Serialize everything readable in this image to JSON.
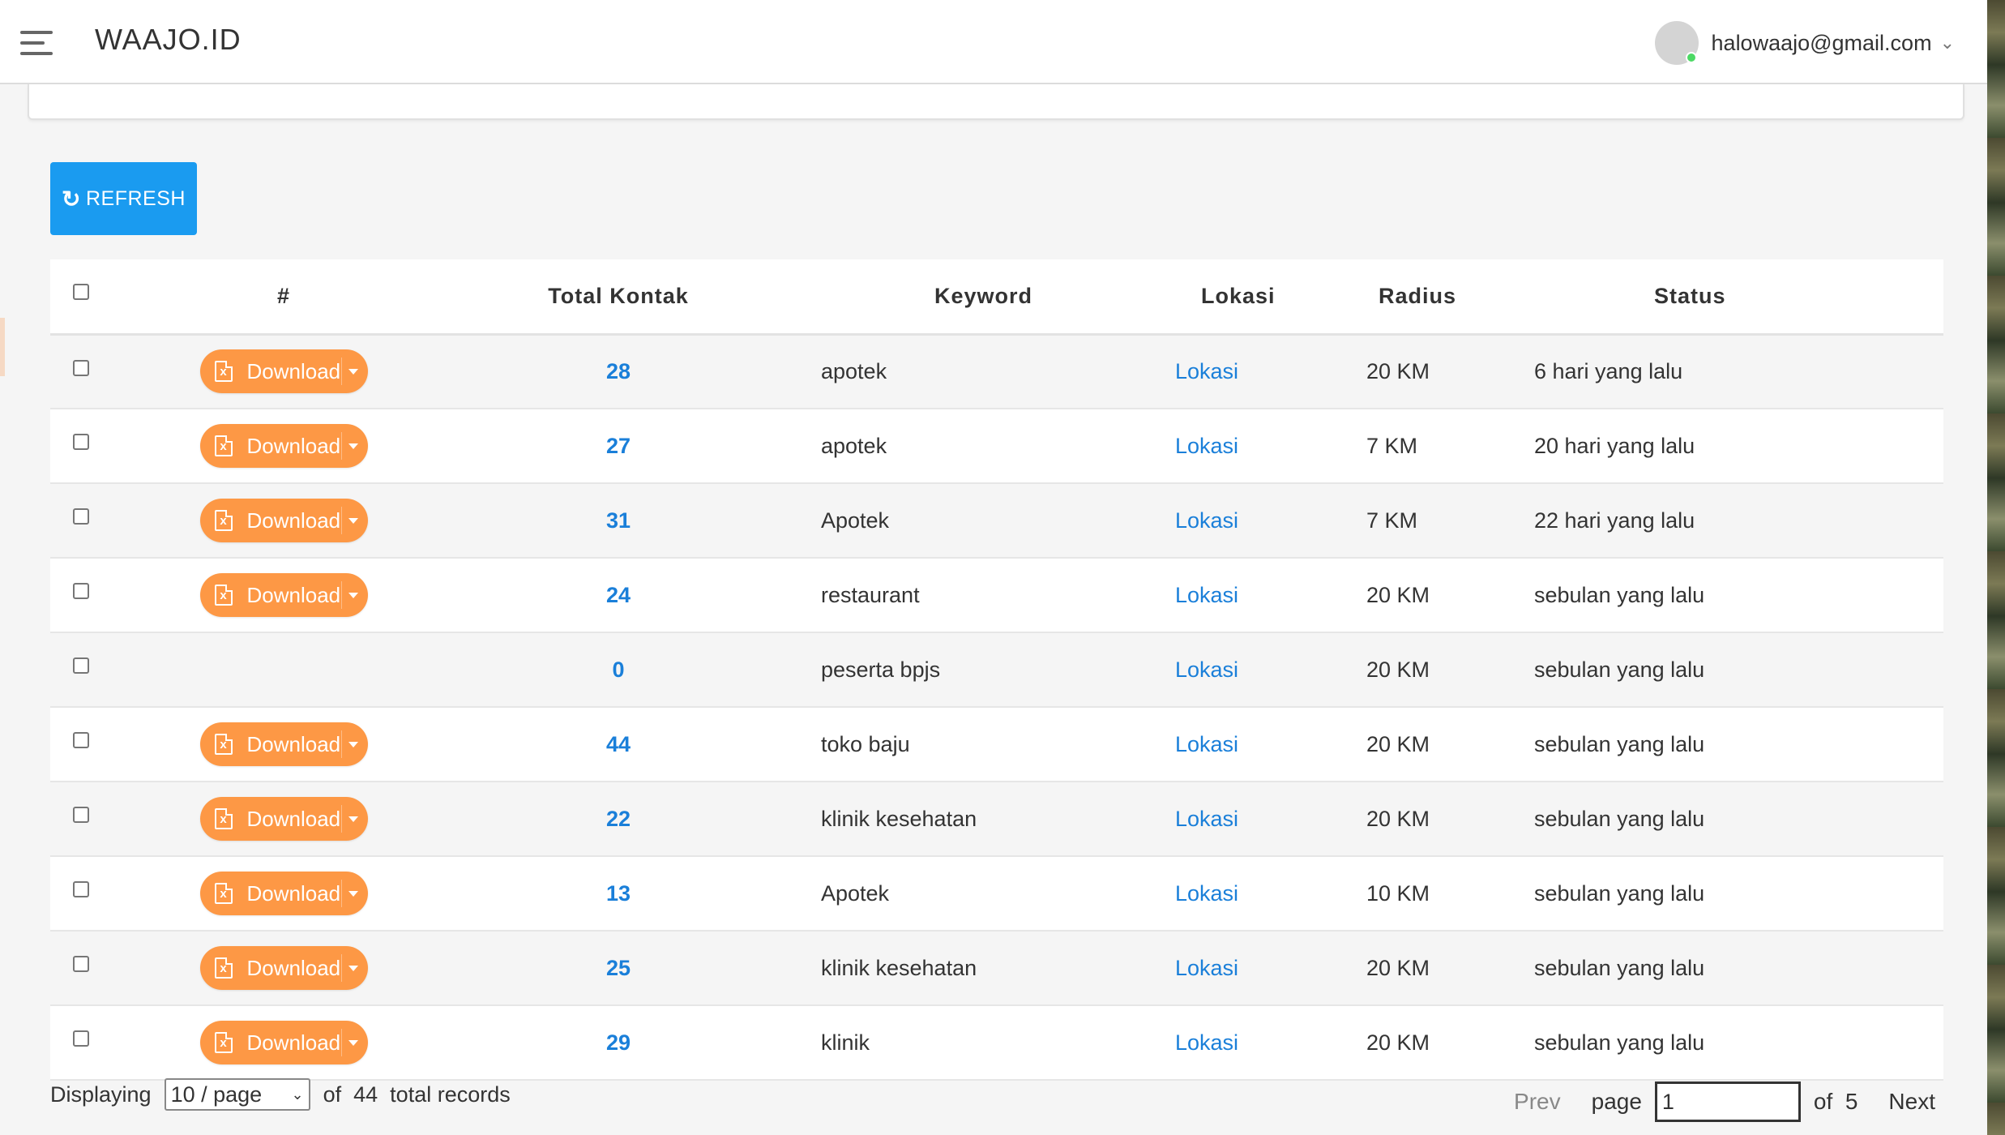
{
  "header": {
    "brand": "WAAJO.ID",
    "user_email": "halowaajo@gmail.com"
  },
  "toolbar": {
    "refresh_label": "REFRESH"
  },
  "table": {
    "columns": [
      "#",
      "Total  Kontak",
      "Keyword",
      "Lokasi",
      "Radius",
      "Status"
    ],
    "download_label": "Download",
    "rows": [
      {
        "has_download": true,
        "total": "28",
        "keyword": "apotek",
        "lokasi": "Lokasi",
        "radius": "20  KM",
        "status": "6  hari  yang  lalu"
      },
      {
        "has_download": true,
        "total": "27",
        "keyword": "apotek",
        "lokasi": "Lokasi",
        "radius": "7  KM",
        "status": "20  hari  yang  lalu"
      },
      {
        "has_download": true,
        "total": "31",
        "keyword": "Apotek",
        "lokasi": "Lokasi",
        "radius": "7  KM",
        "status": "22  hari  yang  lalu"
      },
      {
        "has_download": true,
        "total": "24",
        "keyword": "restaurant",
        "lokasi": "Lokasi",
        "radius": "20  KM",
        "status": "sebulan  yang  lalu"
      },
      {
        "has_download": false,
        "total": "0",
        "keyword": "peserta  bpjs",
        "lokasi": "Lokasi",
        "radius": "20  KM",
        "status": "sebulan  yang  lalu"
      },
      {
        "has_download": true,
        "total": "44",
        "keyword": "toko  baju",
        "lokasi": "Lokasi",
        "radius": "20  KM",
        "status": "sebulan  yang  lalu"
      },
      {
        "has_download": true,
        "total": "22",
        "keyword": "klinik  kesehatan",
        "lokasi": "Lokasi",
        "radius": "20  KM",
        "status": "sebulan  yang  lalu"
      },
      {
        "has_download": true,
        "total": "13",
        "keyword": "Apotek",
        "lokasi": "Lokasi",
        "radius": "10  KM",
        "status": "sebulan  yang  lalu"
      },
      {
        "has_download": true,
        "total": "25",
        "keyword": "klinik  kesehatan",
        "lokasi": "Lokasi",
        "radius": "20  KM",
        "status": "sebulan  yang  lalu"
      },
      {
        "has_download": true,
        "total": "29",
        "keyword": "klinik",
        "lokasi": "Lokasi",
        "radius": "20  KM",
        "status": "sebulan  yang  lalu"
      }
    ]
  },
  "footer": {
    "displaying_label": "Displaying",
    "per_page_value": "10 / page",
    "of_label": "of",
    "total_count": "44",
    "total_records_label": "total  records",
    "prev_label": "Prev",
    "page_label": "page",
    "page_value": "1",
    "of_pages_label": "of",
    "total_pages": "5",
    "next_label": "Next"
  },
  "colors": {
    "accent_blue": "#1a9bf0",
    "link_blue": "#1a7fd9",
    "download_orange": "#fd9845"
  }
}
